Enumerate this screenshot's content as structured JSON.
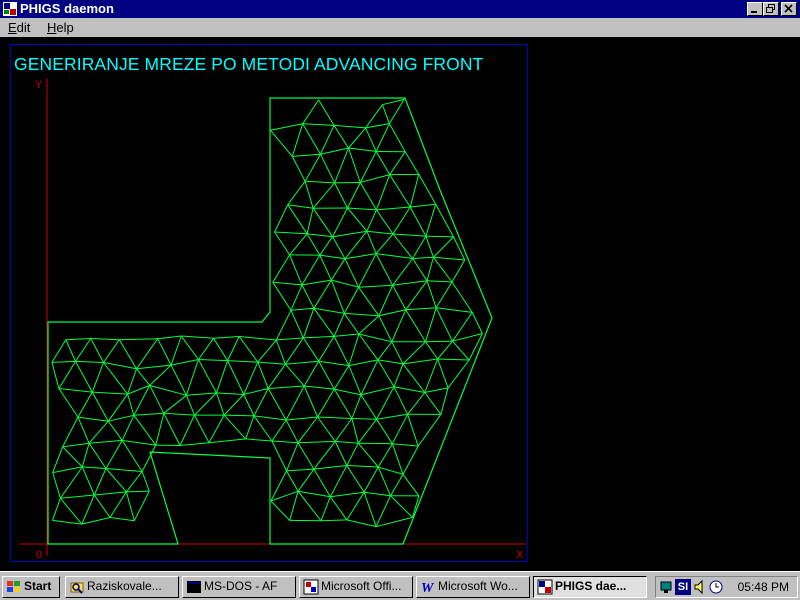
{
  "window": {
    "title": "PHIGS daemon",
    "minimize_icon": "minimize-icon",
    "restore_icon": "restore-icon",
    "close_icon": "close-icon"
  },
  "menu": {
    "items": [
      "Edit",
      "Help"
    ]
  },
  "plot": {
    "title": "GENERIRANJE MREZE PO METODI ADVANCING FRONT",
    "y_axis_label": "Y",
    "x_axis_label": "X",
    "origin_label": "0",
    "colors": {
      "background": "#000000",
      "title": "#00ffff",
      "mesh": "#00ff40",
      "axes": "#d00000",
      "viewport_border": "#0000c0"
    }
  },
  "taskbar": {
    "start_label": "Start",
    "tasks": [
      {
        "label": "Raziskovale...",
        "icon": "explorer-icon"
      },
      {
        "label": "MS-DOS - AF",
        "icon": "msdos-icon"
      },
      {
        "label": "Microsoft Offi...",
        "icon": "office-icon"
      },
      {
        "label": "Microsoft Wo...",
        "icon": "word-icon"
      },
      {
        "label": "PHIGS dae...",
        "icon": "phigs-icon",
        "active": true
      }
    ],
    "tray": {
      "language": "SI",
      "clock": "05:48 PM",
      "icons": [
        "network-icon",
        "keyboard-language-icon",
        "volume-icon",
        "scheduler-icon"
      ]
    }
  }
}
